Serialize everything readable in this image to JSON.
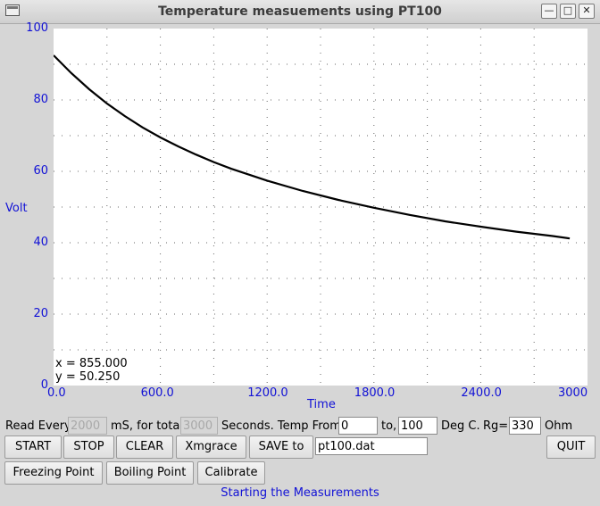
{
  "window": {
    "title": "Temperature measuements using PT100",
    "min_glyph": "—",
    "max_glyph": "□",
    "close_glyph": "✕"
  },
  "chart_data": {
    "type": "line",
    "title": "",
    "xlabel": "Time",
    "ylabel": "Volt",
    "xlim": [
      0,
      3000
    ],
    "ylim": [
      0,
      100
    ],
    "x_tick_labels": [
      "0.0",
      "600.0",
      "1200.0",
      "1800.0",
      "2400.0",
      "3000"
    ],
    "y_tick_labels": [
      "0",
      "20",
      "40",
      "60",
      "80",
      "100"
    ],
    "grid": true,
    "series": [
      {
        "x": [
          0,
          100,
          200,
          300,
          400,
          500,
          600,
          700,
          800,
          900,
          1000,
          1200,
          1400,
          1600,
          1800,
          2000,
          2200,
          2400,
          2600,
          2800,
          2900
        ],
        "y": [
          92.5,
          87.5,
          83.0,
          79.0,
          75.5,
          72.3,
          69.5,
          67.0,
          64.7,
          62.6,
          60.7,
          57.4,
          54.5,
          52.0,
          49.8,
          47.8,
          46.0,
          44.5,
          43.1,
          41.9,
          41.2
        ]
      }
    ],
    "color": "#000000",
    "tick_color": "#1111d6",
    "grid_color": "#666666"
  },
  "readout": {
    "x_text": "x = 855.000",
    "y_text": "y = 50.250"
  },
  "controls": {
    "read_every_label": "Read Every",
    "read_every_value": "2000",
    "ms_label": "mS, for total",
    "total_value": "3000",
    "seconds_label": "Seconds. Temp From",
    "temp_from_value": "0",
    "to_label": "to,",
    "temp_to_value": "100",
    "degc_label": "Deg C.",
    "rg_label": "Rg=",
    "rg_value": "330",
    "ohm_label": "Ohm",
    "start": "START",
    "stop": "STOP",
    "clear": "CLEAR",
    "xmgrace": "Xmgrace",
    "save_to": "SAVE to",
    "filename": "pt100.dat",
    "quit": "QUIT",
    "freezing": "Freezing Point",
    "boiling": "Boiling Point",
    "calibrate": "Calibrate"
  },
  "status": "Starting the Measurements"
}
